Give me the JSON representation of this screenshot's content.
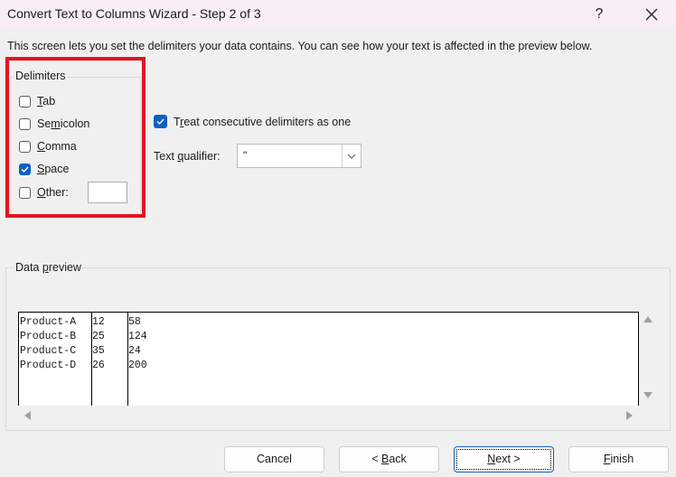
{
  "window": {
    "title": "Convert Text to Columns Wizard - Step 2 of 3",
    "help_label": "?",
    "close_label": "✕"
  },
  "intro_text": "This screen lets you set the delimiters your data contains.  You can see how your text is affected in the preview below.",
  "delimiters": {
    "legend": "Delimiters",
    "items": [
      {
        "key": "T",
        "rest": "ab",
        "pre": "",
        "checked": false
      },
      {
        "key": "m",
        "rest": "icolon",
        "pre": "Se",
        "checked": false
      },
      {
        "key": "C",
        "rest": "omma",
        "pre": "",
        "checked": false
      },
      {
        "key": "S",
        "rest": "pace",
        "pre": "",
        "checked": true
      },
      {
        "key": "O",
        "rest": "ther:",
        "pre": "",
        "checked": false
      }
    ],
    "other_value": ""
  },
  "options": {
    "consecutive": {
      "pre": "T",
      "key": "r",
      "rest": "eat consecutive delimiters as one",
      "checked": true
    },
    "text_qualifier": {
      "pre": "Text ",
      "key": "q",
      "rest": "ualifier:",
      "value": "\""
    }
  },
  "preview": {
    "legend_pre": "Data ",
    "legend_key": "p",
    "legend_rest": "review",
    "rows": [
      [
        "Product-A",
        "12",
        "58"
      ],
      [
        "Product-B",
        "25",
        "124"
      ],
      [
        "Product-C",
        "35",
        "24"
      ],
      [
        "Product-D",
        "26",
        "200"
      ]
    ]
  },
  "buttons": {
    "cancel": {
      "pre": "Cancel",
      "key": "",
      "rest": ""
    },
    "back": {
      "pre": "< ",
      "key": "B",
      "rest": "ack"
    },
    "next": {
      "pre": "",
      "key": "N",
      "rest": "ext >"
    },
    "finish": {
      "pre": "",
      "key": "F",
      "rest": "inish"
    }
  },
  "colors": {
    "accent": "#0f5ec4",
    "highlight_box": "#e3131f",
    "titlebar": "#f8eef4",
    "dialog_bg": "#f0f0f0"
  }
}
